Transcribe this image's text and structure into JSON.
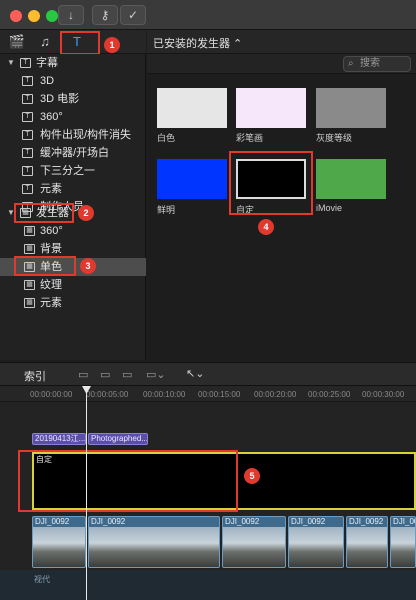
{
  "titlebar": {
    "download_icon": "download-arrow-icon",
    "key_icon": "key-icon",
    "check_icon": "checkmark-circle-icon"
  },
  "library_tabs": {
    "tab1_icon": "clapper-icon",
    "tab2_icon": "music-photo-icon",
    "tab3_icon": "titles-generators-icon"
  },
  "browser": {
    "dropdown_label": "已安装的发生器 ⌃",
    "search_placeholder": "搜索"
  },
  "sidebar": {
    "root_label": "字幕",
    "root_items": [
      "3D",
      "3D 电影",
      "360°",
      "构件出现/构件消失",
      "缓冲器/开场白",
      "下三分之一",
      "元素",
      "制作人员"
    ],
    "gen_label": "发生器",
    "gen_items": [
      "360°",
      "背景",
      "单色",
      "纹理",
      "元素"
    ]
  },
  "thumbnails": [
    {
      "label": "白色",
      "color": "#e6e6e6"
    },
    {
      "label": "彩笔画",
      "color": "#f6e8fa"
    },
    {
      "label": "灰度等级",
      "color": "#8a8a8a"
    },
    {
      "label": "鲜明",
      "color": "#0035ff"
    },
    {
      "label": "自定",
      "color": "#000000"
    },
    {
      "label": "iMovie",
      "color": "#4fa84a"
    }
  ],
  "annotations": {
    "b1": "1",
    "b2": "2",
    "b3": "3",
    "b4": "4",
    "b5": "5"
  },
  "timeline": {
    "index_label": "索引",
    "ticks": [
      "00:00:00:00",
      "00:00:05:00",
      "00:00:10:00",
      "00:00:15:00",
      "00:00:20:00",
      "00:00:25:00",
      "00:00:30:00"
    ],
    "title_chip1": "20190413江...",
    "title_chip2": "Photographed...",
    "generator_clip_label": "自定",
    "video_clip_label": "DJI_0092",
    "track_label": "视代"
  }
}
